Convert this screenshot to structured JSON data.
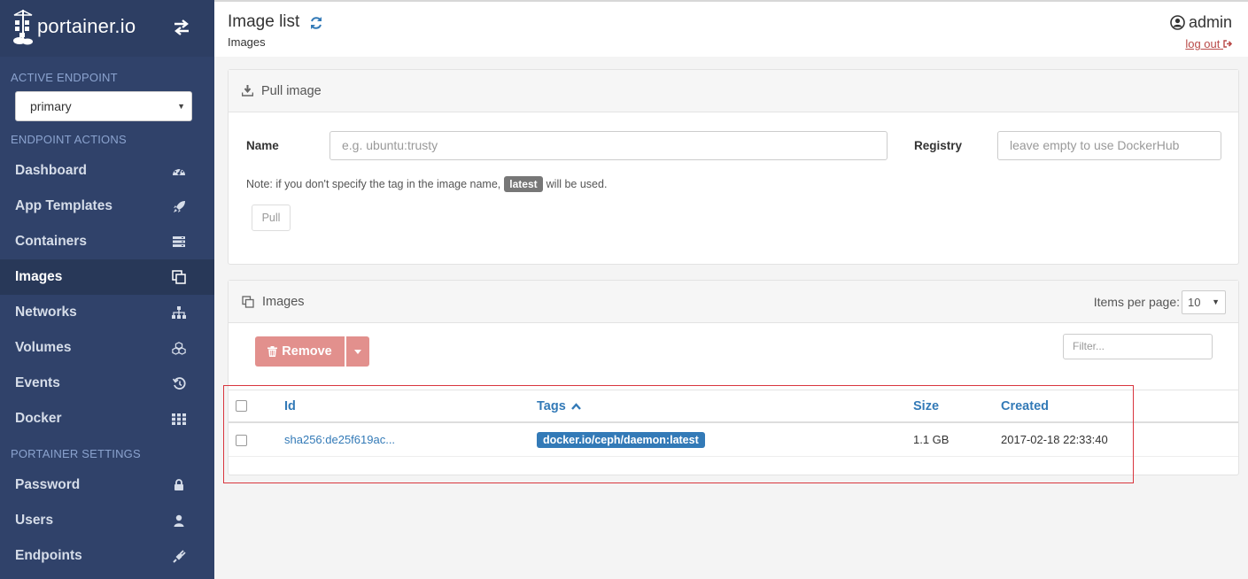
{
  "app": {
    "brand": "portainer.io"
  },
  "sidebar": {
    "active_endpoint_title": "ACTIVE ENDPOINT",
    "endpoint_selected": "primary",
    "endpoint_actions_title": "ENDPOINT ACTIONS",
    "portainer_settings_title": "PORTAINER SETTINGS",
    "items": [
      {
        "label": "Dashboard",
        "icon": "tachometer-icon"
      },
      {
        "label": "App Templates",
        "icon": "rocket-icon"
      },
      {
        "label": "Containers",
        "icon": "server-icon"
      },
      {
        "label": "Images",
        "icon": "clone-icon",
        "active": true
      },
      {
        "label": "Networks",
        "icon": "sitemap-icon"
      },
      {
        "label": "Volumes",
        "icon": "cubes-icon"
      },
      {
        "label": "Events",
        "icon": "history-icon"
      },
      {
        "label": "Docker",
        "icon": "th-icon"
      }
    ],
    "settings_items": [
      {
        "label": "Password",
        "icon": "lock-icon"
      },
      {
        "label": "Users",
        "icon": "user-icon"
      },
      {
        "label": "Endpoints",
        "icon": "plug-icon"
      }
    ]
  },
  "header": {
    "title": "Image list",
    "breadcrumb": "Images",
    "username": "admin",
    "logout": "log out"
  },
  "pull": {
    "title": "Pull image",
    "name_label": "Name",
    "name_placeholder": "e.g. ubuntu:trusty",
    "registry_label": "Registry",
    "registry_placeholder": "leave empty to use DockerHub",
    "note_before": "Note: if you don't specify the tag in the image name,",
    "note_tag": "latest",
    "note_after": "will be used.",
    "button": "Pull"
  },
  "images": {
    "title": "Images",
    "items_per_page_label": "Items per page:",
    "items_per_page": "10",
    "remove_button": "Remove",
    "filter_placeholder": "Filter...",
    "columns": {
      "id": "Id",
      "tags": "Tags",
      "size": "Size",
      "created": "Created"
    },
    "rows": [
      {
        "id": "sha256:de25f619ac...",
        "tag": "docker.io/ceph/daemon:latest",
        "size": "1.1 GB",
        "created": "2017-02-18 22:33:40"
      }
    ]
  },
  "colors": {
    "sidebar_bg": "#30426a",
    "link": "#337ab7",
    "danger": "#e2908d",
    "highlight": "#d9363e"
  }
}
